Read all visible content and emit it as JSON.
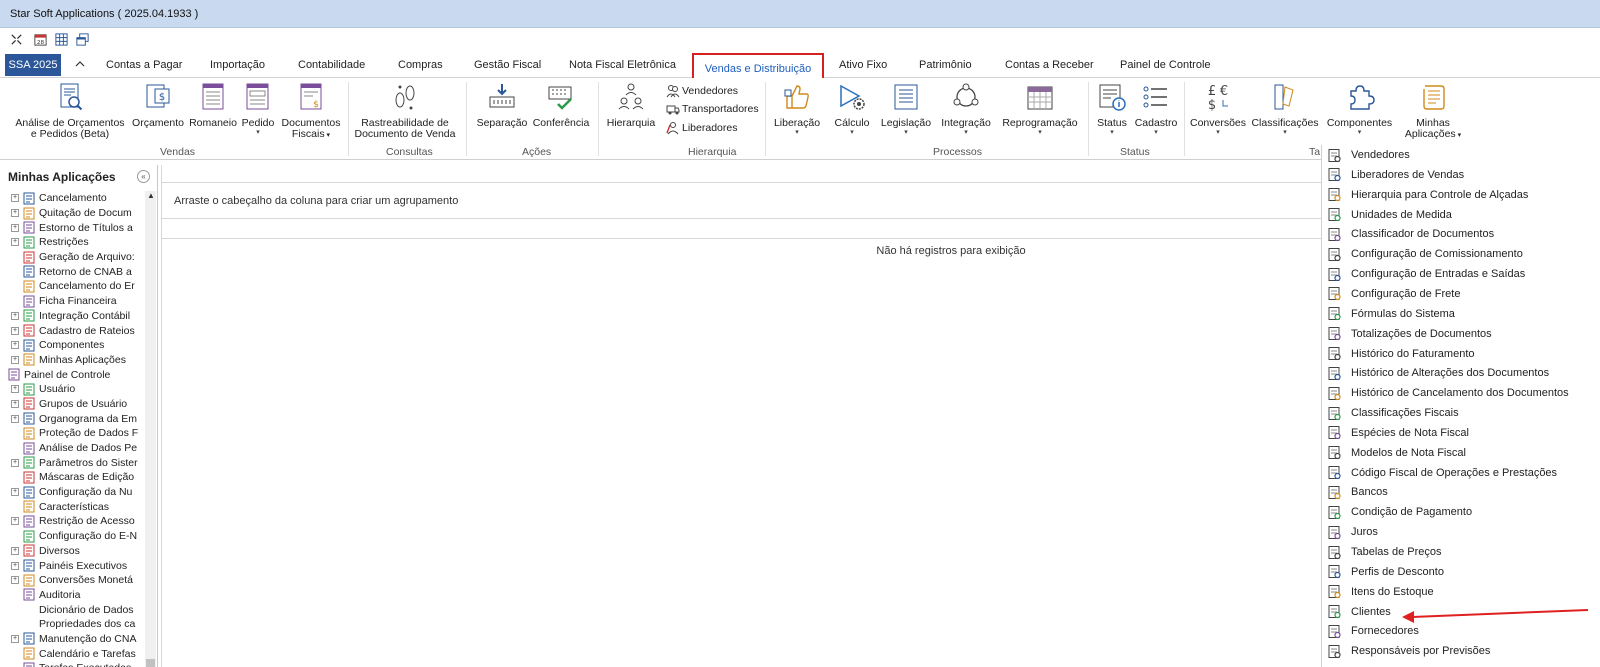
{
  "window": {
    "title": "Star Soft Applications ( 2025.04.1933 )"
  },
  "file_tab": "SSA 2025",
  "tabs": [
    "Contas a Pagar",
    "Importação",
    "Contabilidade",
    "Compras",
    "Gestão Fiscal",
    "Nota Fiscal Eletrônica",
    "Vendas e Distribuição",
    "Ativo Fixo",
    "Patrimônio",
    "Contas a Receber",
    "Painel de Controle"
  ],
  "ribbon": {
    "vendas": {
      "analise_l1": "Análise de Orçamentos",
      "analise_l2": "e Pedidos (Beta)",
      "orcamento": "Orçamento",
      "romaneio": "Romaneio",
      "pedido": "Pedido",
      "documentos_l1": "Documentos",
      "documentos_l2": "Fiscais",
      "group": "Vendas"
    },
    "consultas": {
      "rastreabilidade_l1": "Rastreabilidade de",
      "rastreabilidade_l2": "Documento de Venda",
      "group": "Consultas"
    },
    "acoes": {
      "separacao": "Separação",
      "conferencia": "Conferência",
      "group": "Ações"
    },
    "hierarquia": {
      "hierarquia": "Hierarquia",
      "vendedores": "Vendedores",
      "transportadores": "Transportadores",
      "liberadores": "Liberadores",
      "group": "Hierarquia"
    },
    "processos": {
      "liberacao": "Liberação",
      "calculo": "Cálculo",
      "legislacao": "Legislação",
      "integracao": "Integração",
      "reprogramacao": "Reprogramação",
      "group": "Processos"
    },
    "status": {
      "status": "Status",
      "cadastro": "Cadastro",
      "group": "Status"
    },
    "tabelas": {
      "conversoes": "Conversões",
      "classificacoes": "Classificações",
      "componentes": "Componentes",
      "group": "Ta"
    },
    "minhas": {
      "l1": "Minhas",
      "l2": "Aplicações"
    }
  },
  "sidebar": {
    "title": "Minhas Aplicações",
    "items": [
      {
        "label": "Cancelamento",
        "expand": true
      },
      {
        "label": "Quitação de Docum",
        "expand": true
      },
      {
        "label": "Estorno de Títulos a",
        "expand": true
      },
      {
        "label": "Restrições",
        "expand": true
      },
      {
        "label": "Geração de Arquivo:",
        "expand": false
      },
      {
        "label": "Retorno de CNAB a",
        "expand": false
      },
      {
        "label": "Cancelamento do Er",
        "expand": false
      },
      {
        "label": "Ficha Financeira",
        "expand": false
      },
      {
        "label": "Integração Contábil",
        "expand": true
      },
      {
        "label": "Cadastro de Rateios",
        "expand": true
      },
      {
        "label": "Componentes",
        "expand": true
      },
      {
        "label": "Minhas Aplicações",
        "expand": true
      },
      {
        "label": "Painel de Controle",
        "root": true
      },
      {
        "label": "Usuário",
        "expand": true
      },
      {
        "label": "Grupos de Usuário",
        "expand": true
      },
      {
        "label": "Organograma da Em",
        "expand": true
      },
      {
        "label": "Proteção de Dados F",
        "expand": false
      },
      {
        "label": "Análise de Dados Pe",
        "expand": false
      },
      {
        "label": "Parâmetros do Sister",
        "expand": true
      },
      {
        "label": "Máscaras de Edição",
        "expand": false
      },
      {
        "label": "Configuração da Nu",
        "expand": true
      },
      {
        "label": "Características",
        "expand": false
      },
      {
        "label": "Restrição de Acesso",
        "expand": true
      },
      {
        "label": "Configuração do E-N",
        "expand": false
      },
      {
        "label": "Diversos",
        "expand": true
      },
      {
        "label": "Painéis Executivos",
        "expand": true
      },
      {
        "label": "Conversões Monetá",
        "expand": true
      },
      {
        "label": "Auditoria",
        "expand": false
      },
      {
        "label": "Dicionário de Dados",
        "expand": false,
        "noicon": true
      },
      {
        "label": "Propriedades dos ca",
        "expand": false,
        "noicon": true
      },
      {
        "label": "Manutenção do CNA",
        "expand": true
      },
      {
        "label": "Calendário e Tarefas",
        "expand": false
      },
      {
        "label": "Tarefas Executadas",
        "expand": false
      }
    ]
  },
  "grid": {
    "group_hint": "Arraste o cabeçalho da coluna para criar um agrupamento",
    "empty": "Não há registros para exibição"
  },
  "menu": {
    "items": [
      "Vendedores",
      "Liberadores de Vendas",
      "Hierarquia para Controle de Alçadas",
      "Unidades de Medida",
      "Classificador de Documentos",
      "Configuração de Comissionamento",
      "Configuração de Entradas e Saídas",
      "Configuração de Frete",
      "Fórmulas do Sistema",
      "Totalizações de Documentos",
      "Histórico do Faturamento",
      "Histórico de Alterações dos Documentos",
      "Histórico de Cancelamento dos Documentos",
      "Classificações Fiscais",
      "Espécies de Nota Fiscal",
      "Modelos de Nota Fiscal",
      "Código Fiscal de Operações e Prestações",
      "Bancos",
      "Condição de Pagamento",
      "Juros",
      "Tabelas de Preços",
      "Perfis de Desconto",
      "Itens do Estoque",
      "Clientes",
      "Fornecedores",
      "Responsáveis por Previsões"
    ]
  },
  "colors": {
    "accent": "#2b579a",
    "highlight": "#d42020",
    "selected_bg": "#cde3f7",
    "titlebar": "#c9d9ef"
  }
}
